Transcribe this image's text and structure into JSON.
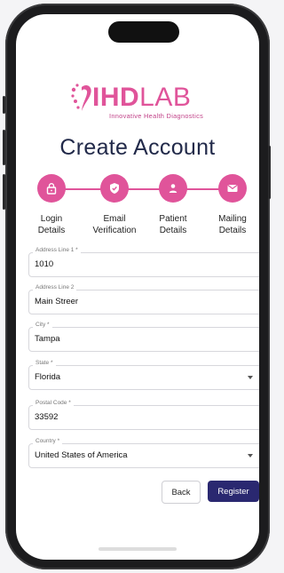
{
  "brand": {
    "name_bold": "IHD",
    "name_light": "LAB",
    "tagline": "Innovative Health Diagnostics",
    "color": "#e0549a"
  },
  "page_title": "Create Account",
  "steps": [
    {
      "label_line1": "Login",
      "label_line2": "Details",
      "icon": "lock-icon"
    },
    {
      "label_line1": "Email",
      "label_line2": "Verification",
      "icon": "shield-check-icon"
    },
    {
      "label_line1": "Patient",
      "label_line2": "Details",
      "icon": "person-icon"
    },
    {
      "label_line1": "Mailing",
      "label_line2": "Details",
      "icon": "mail-icon"
    }
  ],
  "form": {
    "address_line_1": {
      "label": "Address Line 1 *",
      "value": "1010"
    },
    "address_line_2": {
      "label": "Address Line 2",
      "value": "Main Streer"
    },
    "city": {
      "label": "City *",
      "value": "Tampa"
    },
    "state": {
      "label": "State *",
      "value": "Florida"
    },
    "postal_code": {
      "label": "Postal Code *",
      "value": "33592"
    },
    "country": {
      "label": "Country *",
      "value": "United States of America"
    }
  },
  "actions": {
    "back_label": "Back",
    "register_label": "Register"
  },
  "colors": {
    "accent": "#e0549a",
    "primary_button": "#2a2870",
    "title": "#222a4a"
  }
}
